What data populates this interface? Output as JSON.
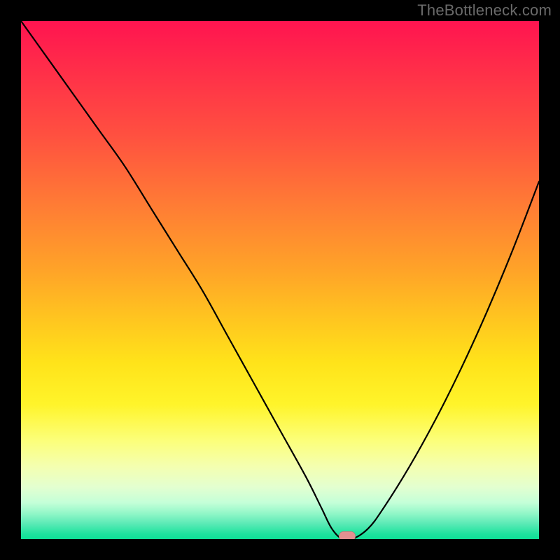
{
  "watermark": "TheBottleneck.com",
  "colors": {
    "background": "#000000",
    "curve": "#000000",
    "marker": "#e39090",
    "watermark_text": "#6a6a6a"
  },
  "chart_data": {
    "type": "line",
    "title": "",
    "xlabel": "",
    "ylabel": "",
    "xlim": [
      0,
      100
    ],
    "ylim": [
      0,
      100
    ],
    "grid": false,
    "legend": false,
    "x": [
      0,
      5,
      10,
      15,
      20,
      25,
      30,
      35,
      40,
      45,
      50,
      55,
      58,
      60,
      62,
      64,
      67,
      70,
      75,
      80,
      85,
      90,
      95,
      100
    ],
    "values": [
      100,
      93,
      86,
      79,
      72,
      64,
      56,
      48,
      39,
      30,
      21,
      12,
      6,
      2,
      0,
      0,
      2,
      6,
      14,
      23,
      33,
      44,
      56,
      69
    ],
    "marker": {
      "x": 63,
      "y": 0
    },
    "description": "V-shaped bottleneck curve on a vertical red-to-green gradient background. The curve descends steeply from top-left, flattens to a minimum around x≈62–64 at y=0, then rises again toward the right edge. A small rounded pink marker sits at the curve's minimum."
  }
}
